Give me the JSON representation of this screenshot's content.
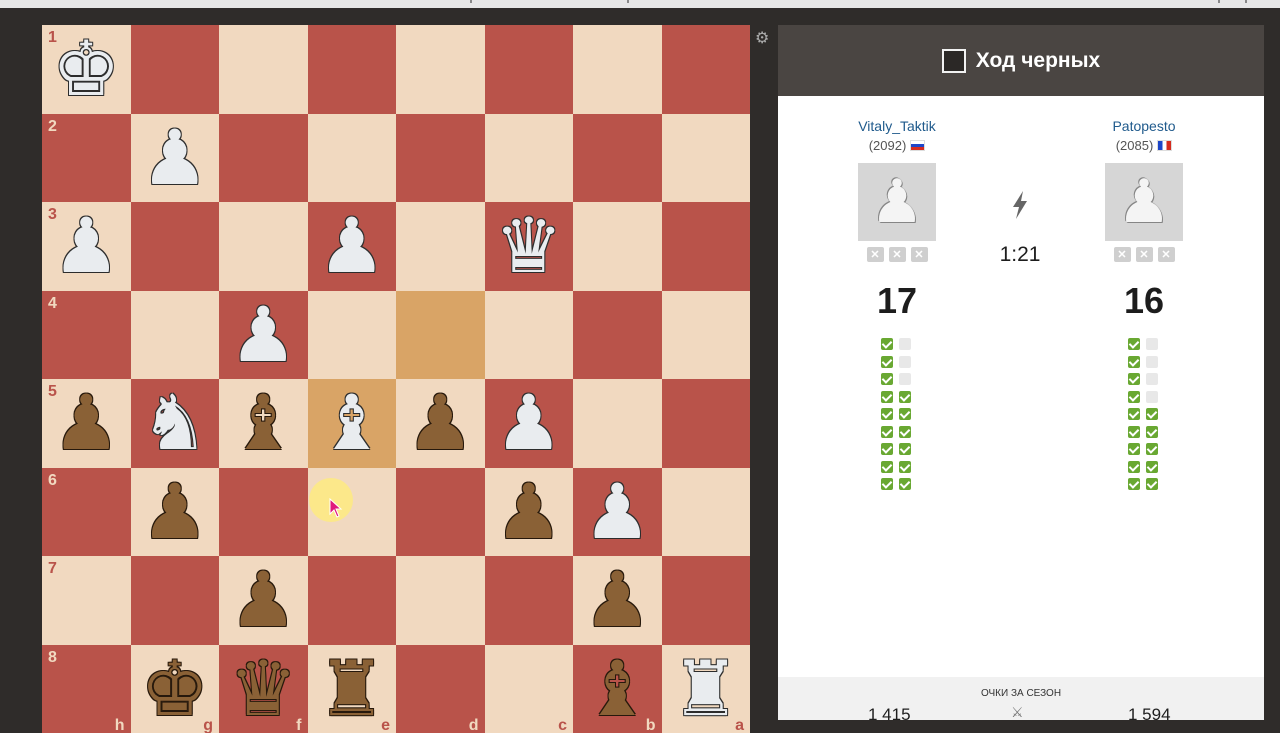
{
  "board": {
    "ranks": [
      "1",
      "2",
      "3",
      "4",
      "5",
      "6",
      "7",
      "8"
    ],
    "files": [
      "h",
      "g",
      "f",
      "e",
      "d",
      "c",
      "b",
      "a"
    ],
    "highlight_squares": [
      "d4",
      "e5"
    ],
    "pieces": {
      "h1": {
        "glyph": "♚",
        "color": "w",
        "name": "white-king"
      },
      "g2": {
        "glyph": "♟",
        "color": "w",
        "name": "white-pawn"
      },
      "h3": {
        "glyph": "♟",
        "color": "w",
        "name": "white-pawn"
      },
      "e3": {
        "glyph": "♟",
        "color": "w",
        "name": "white-pawn"
      },
      "c3": {
        "glyph": "♛",
        "color": "w",
        "name": "white-queen"
      },
      "f4": {
        "glyph": "♟",
        "color": "w",
        "name": "white-pawn"
      },
      "h5": {
        "glyph": "♟",
        "color": "b",
        "name": "black-pawn"
      },
      "g5": {
        "glyph": "♞",
        "color": "w",
        "name": "white-knight"
      },
      "f5": {
        "glyph": "♝",
        "color": "b",
        "name": "black-bishop"
      },
      "e5": {
        "glyph": "♝",
        "color": "w",
        "name": "white-bishop"
      },
      "d5": {
        "glyph": "♟",
        "color": "b",
        "name": "black-pawn"
      },
      "c5": {
        "glyph": "♟",
        "color": "w",
        "name": "white-pawn"
      },
      "g6": {
        "glyph": "♟",
        "color": "b",
        "name": "black-pawn"
      },
      "c6": {
        "glyph": "♟",
        "color": "b",
        "name": "black-pawn"
      },
      "b6": {
        "glyph": "♟",
        "color": "w",
        "name": "white-pawn"
      },
      "f7": {
        "glyph": "♟",
        "color": "b",
        "name": "black-pawn"
      },
      "b7": {
        "glyph": "♟",
        "color": "b",
        "name": "black-pawn"
      },
      "g8": {
        "glyph": "♚",
        "color": "b",
        "name": "black-king"
      },
      "f8": {
        "glyph": "♛",
        "color": "b",
        "name": "black-queen"
      },
      "e8": {
        "glyph": "♜",
        "color": "b",
        "name": "black-rook"
      },
      "b8": {
        "glyph": "♝",
        "color": "b",
        "name": "black-bishop"
      },
      "a8": {
        "glyph": "♜",
        "color": "w",
        "name": "white-rook"
      }
    }
  },
  "header": {
    "turn_text": "Ход черных"
  },
  "players": {
    "left": {
      "name": "Vitaly_Taktik",
      "rating": "(2092)",
      "flag": "ru",
      "score": "17",
      "checks": [
        [
          1,
          0
        ],
        [
          1,
          0
        ],
        [
          1,
          0
        ],
        [
          1,
          1
        ],
        [
          1,
          1
        ],
        [
          1,
          1
        ],
        [
          1,
          1
        ],
        [
          1,
          1
        ],
        [
          1,
          1
        ]
      ]
    },
    "right": {
      "name": "Patopesto",
      "rating": "(2085)",
      "flag": "fr",
      "score": "16",
      "checks": [
        [
          1,
          0
        ],
        [
          1,
          0
        ],
        [
          1,
          0
        ],
        [
          1,
          0
        ],
        [
          1,
          1
        ],
        [
          1,
          1
        ],
        [
          1,
          1
        ],
        [
          1,
          1
        ],
        [
          1,
          1
        ]
      ]
    }
  },
  "timer": "1:21",
  "season": {
    "label": "ОЧКИ ЗА СЕЗОН",
    "left": "1 415",
    "right": "1 594"
  },
  "colors": {
    "light_square": "#f1d9c0",
    "dark_square": "#b9534a",
    "highlight": "#d9a466",
    "check_green": "#69a832"
  }
}
